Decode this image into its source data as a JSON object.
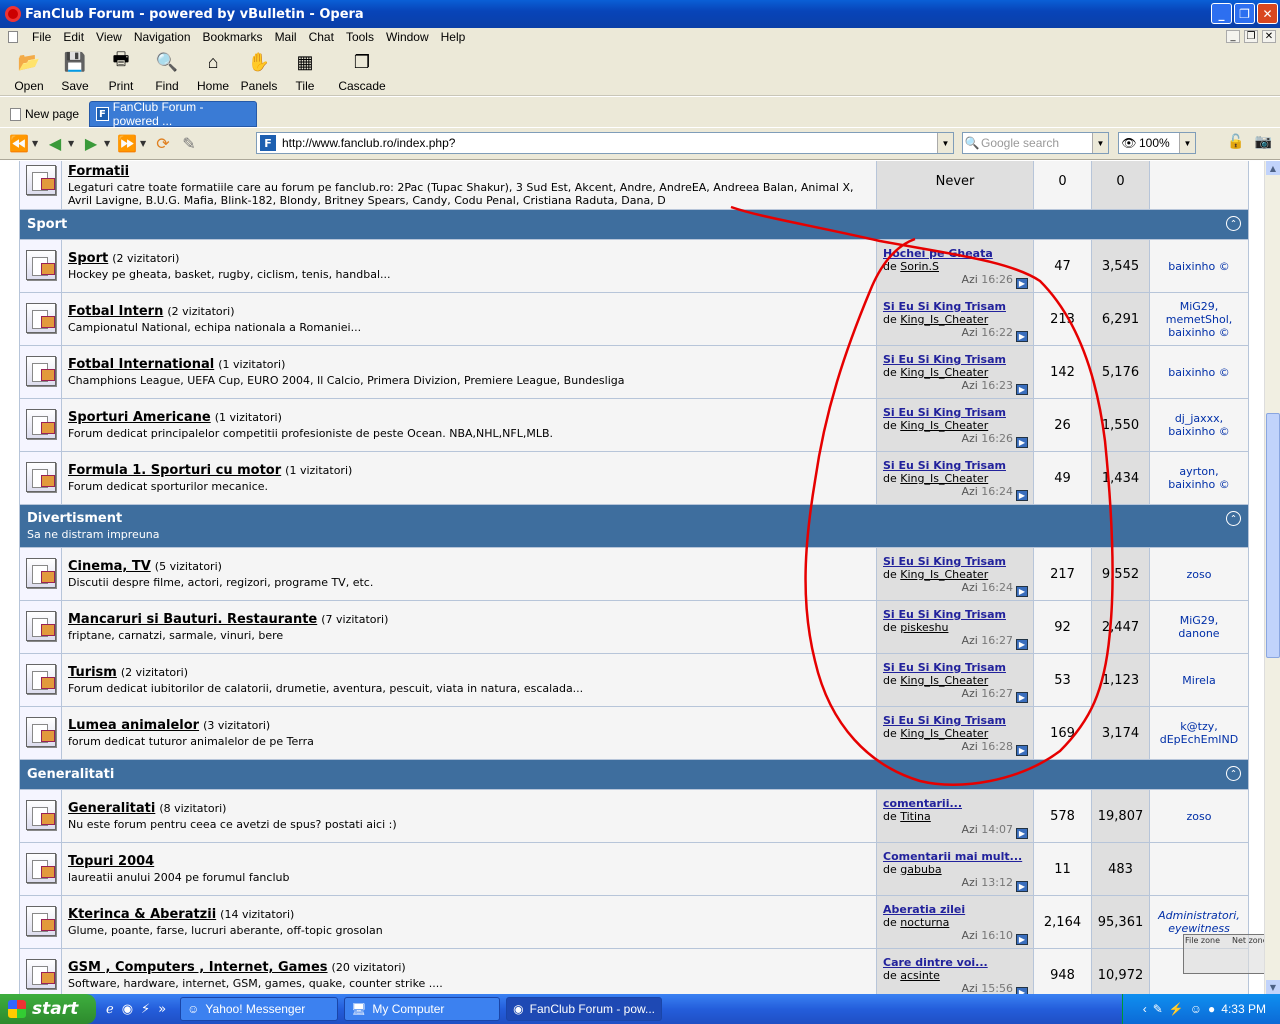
{
  "window": {
    "title": "FanClub Forum - powered by vBulletin - Opera"
  },
  "menu": [
    "File",
    "Edit",
    "View",
    "Navigation",
    "Bookmarks",
    "Mail",
    "Chat",
    "Tools",
    "Window",
    "Help"
  ],
  "toolbar": [
    {
      "label": "Open",
      "icon": "folder-icon"
    },
    {
      "label": "Save",
      "icon": "disk-icon"
    },
    {
      "label": "Print",
      "icon": "printer-icon"
    },
    {
      "label": "Find",
      "icon": "magnifier-icon"
    },
    {
      "label": "Home",
      "icon": "home-icon"
    },
    {
      "label": "Panels",
      "icon": "panels-icon"
    },
    {
      "label": "Tile",
      "icon": "tile-icon"
    },
    {
      "label": "Cascade",
      "icon": "cascade-icon"
    }
  ],
  "tabs": {
    "new_page": "New page",
    "active": "FanClub Forum - powered ..."
  },
  "address": {
    "url": "http://www.fanclub.ro/index.php?",
    "search_placeholder": "Google search",
    "zoom": "100%"
  },
  "top_forum": {
    "title": "Formatii",
    "desc": "Legaturi catre toate formatiile care au forum pe fanclub.ro: 2Pac (Tupac Shakur), 3 Sud Est, Akcent, Andre, AndreEA, Andreea Balan, Animal X, Avril Lavigne, B.U.G. Mafia, Blink-182, Blondy, Britney Spears, Candy, Codu Penal, Cristiana Raduta, Dana, D",
    "last": "Never",
    "threads": "0",
    "posts": "0"
  },
  "categories": [
    {
      "name": "Sport",
      "sub": "",
      "forums": [
        {
          "title": "Sport",
          "vis": "(2 vizitatori)",
          "desc": "Hockey pe gheata, basket, rugby, ciclism, tenis, handbal...",
          "lp_title": "Hochei pe Gheata",
          "lp_by": "Sorin.S",
          "lp_day": "Azi",
          "lp_time": "16:26",
          "threads": "47",
          "posts": "3,545",
          "mods": [
            "baixinho ©"
          ]
        },
        {
          "title": "Fotbal Intern",
          "vis": "(2 vizitatori)",
          "desc": "Campionatul National, echipa nationala a Romaniei...",
          "lp_title": "Si Eu Si King Trisam",
          "lp_by": "King_Is_Cheater",
          "lp_day": "Azi",
          "lp_time": "16:22",
          "threads": "213",
          "posts": "6,291",
          "mods": [
            "MiG29,",
            "memetShol,",
            "baixinho ©"
          ]
        },
        {
          "title": "Fotbal International",
          "vis": "(1 vizitatori)",
          "desc": "Champhions League, UEFA Cup, EURO 2004, Il Calcio, Primera Divizion, Premiere League, Bundesliga",
          "lp_title": "Si Eu Si King Trisam",
          "lp_by": "King_Is_Cheater",
          "lp_day": "Azi",
          "lp_time": "16:23",
          "threads": "142",
          "posts": "5,176",
          "mods": [
            "baixinho ©"
          ]
        },
        {
          "title": "Sporturi Americane",
          "vis": "(1 vizitatori)",
          "desc": "Forum dedicat principalelor competitii profesioniste de peste Ocean. NBA,NHL,NFL,MLB.",
          "lp_title": "Si Eu Si King Trisam",
          "lp_by": "King_Is_Cheater",
          "lp_day": "Azi",
          "lp_time": "16:26",
          "threads": "26",
          "posts": "1,550",
          "mods": [
            "dj_jaxxx,",
            "baixinho ©"
          ]
        },
        {
          "title": "Formula 1. Sporturi cu motor",
          "vis": "(1 vizitatori)",
          "desc": "Forum dedicat sporturilor mecanice.",
          "lp_title": "Si Eu Si King Trisam",
          "lp_by": "King_Is_Cheater",
          "lp_day": "Azi",
          "lp_time": "16:24",
          "threads": "49",
          "posts": "1,434",
          "mods": [
            "ayrton,",
            "baixinho ©"
          ]
        }
      ]
    },
    {
      "name": "Divertisment",
      "sub": "Sa ne distram impreuna",
      "forums": [
        {
          "title": "Cinema, TV",
          "vis": "(5 vizitatori)",
          "desc": "Discutii despre filme, actori, regizori, programe TV, etc.",
          "lp_title": "Si Eu Si King Trisam",
          "lp_by": "King_Is_Cheater",
          "lp_day": "Azi",
          "lp_time": "16:24",
          "threads": "217",
          "posts": "9,552",
          "mods": [
            "zoso"
          ]
        },
        {
          "title": "Mancaruri si Bauturi. Restaurante",
          "vis": "(7 vizitatori)",
          "desc": "friptane, carnatzi, sarmale, vinuri, bere",
          "lp_title": "Si Eu Si King Trisam",
          "lp_by": "piskeshu",
          "lp_day": "Azi",
          "lp_time": "16:27",
          "threads": "92",
          "posts": "2,447",
          "mods": [
            "MiG29,",
            "danone"
          ]
        },
        {
          "title": "Turism",
          "vis": "(2 vizitatori)",
          "desc": "Forum dedicat iubitorilor de calatorii, drumetie, aventura, pescuit, viata in natura, escalada...",
          "lp_title": "Si Eu Si King Trisam",
          "lp_by": "King_Is_Cheater",
          "lp_day": "Azi",
          "lp_time": "16:27",
          "threads": "53",
          "posts": "1,123",
          "mods": [
            "Mirela"
          ]
        },
        {
          "title": "Lumea animalelor",
          "vis": "(3 vizitatori)",
          "desc": "forum dedicat tuturor animalelor de pe Terra",
          "lp_title": "Si Eu Si King Trisam",
          "lp_by": "King_Is_Cheater",
          "lp_day": "Azi",
          "lp_time": "16:28",
          "threads": "169",
          "posts": "3,174",
          "mods": [
            "k@tzy,",
            "dEpEchEmIND"
          ]
        }
      ]
    },
    {
      "name": "Generalitati",
      "sub": "",
      "forums": [
        {
          "title": "Generalitati",
          "vis": "(8 vizitatori)",
          "desc": "Nu este forum pentru ceea ce avetzi de spus? postati aici :)",
          "lp_title": "comentarii...",
          "lp_by": "Titina",
          "lp_day": "Azi",
          "lp_time": "14:07",
          "threads": "578",
          "posts": "19,807",
          "mods": [
            "zoso"
          ]
        },
        {
          "title": "Topuri 2004",
          "vis": "",
          "desc": "laureatii anului 2004 pe forumul fanclub",
          "lp_title": "Comentarii mai mult...",
          "lp_by": "gabuba",
          "lp_day": "Azi",
          "lp_time": "13:12",
          "threads": "11",
          "posts": "483",
          "mods": []
        },
        {
          "title": "Kterinca & Aberatzii",
          "vis": "(14 vizitatori)",
          "desc": "Glume, poante, farse, lucruri aberante, off-topic grosolan",
          "lp_title": "Aberatia zilei",
          "lp_by": "nocturna",
          "lp_day": "Azi",
          "lp_time": "16:10",
          "threads": "2,164",
          "posts": "95,361",
          "mods": [
            "Administratori,",
            "eyewitness"
          ]
        },
        {
          "title": "GSM , Computers , Internet, Games",
          "vis": "(20 vizitatori)",
          "desc": "Software, hardware, internet, GSM, games, quake, counter strike ....",
          "lp_title": "Care dintre voi...",
          "lp_by": "acsinte",
          "lp_day": "Azi",
          "lp_time": "15:56",
          "threads": "948",
          "posts": "10,972",
          "mods": []
        }
      ]
    }
  ],
  "common": {
    "by": "de"
  },
  "status_zones": {
    "file": "File zone",
    "net": "Net zone"
  },
  "taskbar": {
    "start": "start",
    "buttons": [
      "Yahoo! Messenger",
      "My Computer",
      "FanClub Forum - pow..."
    ],
    "clock": "4:33 PM"
  }
}
